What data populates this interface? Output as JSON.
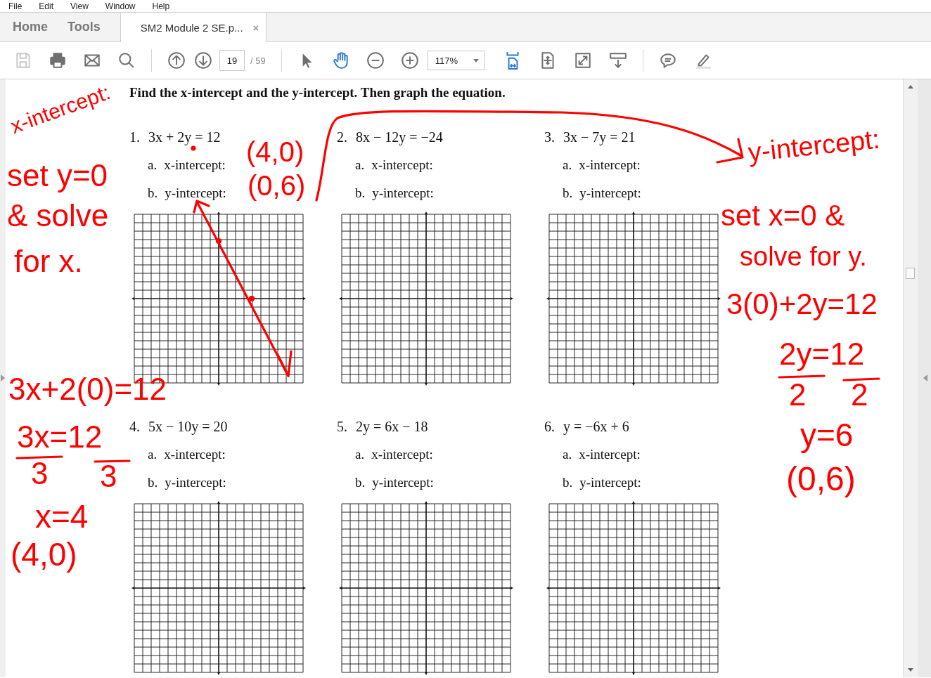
{
  "menu": [
    "File",
    "Edit",
    "View",
    "Window",
    "Help"
  ],
  "tabs": [
    {
      "label": "Home",
      "selected": false
    },
    {
      "label": "Tools",
      "selected": false
    },
    {
      "label": "SM2 Module 2 SE.p...",
      "selected": true,
      "close": "×"
    }
  ],
  "toolbar": {
    "file": [
      {
        "kind": "save",
        "disabled": true
      },
      {
        "kind": "print",
        "disabled": false
      },
      {
        "kind": "email",
        "disabled": false
      },
      {
        "kind": "search",
        "disabled": false
      }
    ],
    "nav": [
      {
        "kind": "prev"
      },
      {
        "kind": "next"
      }
    ],
    "page": "19",
    "page_total": "/ 59",
    "tools": [
      {
        "kind": "select",
        "selected": false
      },
      {
        "kind": "hand",
        "selected": true
      }
    ],
    "zoom": [
      {
        "kind": "zoom_out"
      },
      {
        "kind": "zoom_in"
      }
    ],
    "zoom_value": "117%",
    "view": [
      {
        "kind": "fit_width",
        "selected": true
      },
      {
        "kind": "fit_page",
        "selected": false
      },
      {
        "kind": "fullscreen",
        "selected": false
      },
      {
        "kind": "read",
        "selected": false
      }
    ],
    "annotate": [
      {
        "kind": "comment"
      },
      {
        "kind": "highlight"
      }
    ]
  },
  "document": {
    "instruction": "Find the x-intercept and the y-intercept.  Then graph the equation.",
    "problems": [
      {
        "number": "1.",
        "equation": "3x + 2y = 12",
        "parts": [
          {
            "letter": "a.",
            "label": "x-intercept:"
          },
          {
            "letter": "b.",
            "label": "y-intercept:"
          }
        ]
      },
      {
        "number": "2.",
        "equation": "8x − 12y = −24",
        "parts": [
          {
            "letter": "a.",
            "label": "x-intercept:"
          },
          {
            "letter": "b.",
            "label": "y-intercept:"
          }
        ]
      },
      {
        "number": "3.",
        "equation": "3x − 7y = 21",
        "parts": [
          {
            "letter": "a.",
            "label": "x-intercept:"
          },
          {
            "letter": "b.",
            "label": "y-intercept:"
          }
        ]
      },
      {
        "number": "4.",
        "equation": "5x − 10y = 20",
        "parts": [
          {
            "letter": "a.",
            "label": "x-intercept:"
          },
          {
            "letter": "b.",
            "label": "y-intercept:"
          }
        ]
      },
      {
        "number": "5.",
        "equation": "2y = 6x − 18",
        "parts": [
          {
            "letter": "a.",
            "label": "x-intercept:"
          },
          {
            "letter": "b.",
            "label": "y-intercept:"
          }
        ]
      },
      {
        "number": "6.",
        "equation": "y = −6x + 6",
        "parts": [
          {
            "letter": "a.",
            "label": "x-intercept:"
          },
          {
            "letter": "b.",
            "label": "y-intercept:"
          }
        ]
      }
    ]
  },
  "annotations": [
    {
      "text": "x-intercept:"
    },
    {
      "text": "set y=0"
    },
    {
      "text": "& solve"
    },
    {
      "text": "for x."
    },
    {
      "text": "(4,0)"
    },
    {
      "text": "(0,6)"
    },
    {
      "text": "3x+2(0)=12"
    },
    {
      "text": "3x=12"
    },
    {
      "text": "3"
    },
    {
      "text": "3"
    },
    {
      "text": "x=4"
    },
    {
      "text": "(4,0)"
    },
    {
      "text": "y-intercept:"
    },
    {
      "text": "set x=0 &"
    },
    {
      "text": "solve for y."
    },
    {
      "text": "3(0)+2y=12"
    },
    {
      "text": "2y=12"
    },
    {
      "text": "2"
    },
    {
      "text": "2"
    },
    {
      "text": "y=6"
    },
    {
      "text": "(0,6)"
    }
  ]
}
